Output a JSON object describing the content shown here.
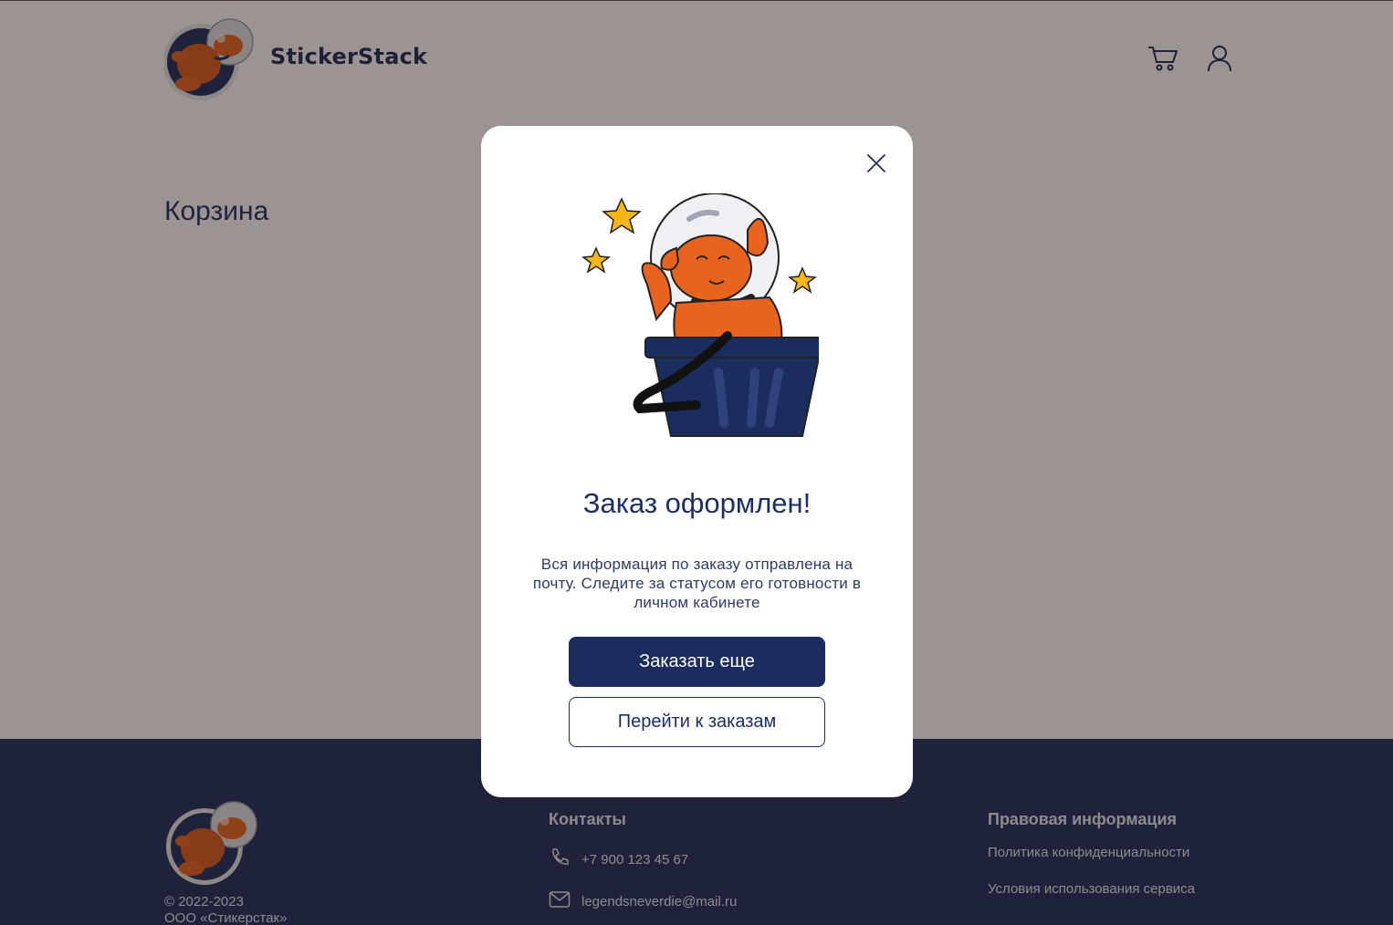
{
  "header": {
    "brand": "StickerStack",
    "cart_icon": "cart-icon",
    "user_icon": "user-icon"
  },
  "main": {
    "title": "Корзина"
  },
  "footer": {
    "copyright_line1": "© 2022-2023",
    "copyright_line2": "ООО «Стикерстак»",
    "contacts_title": "Контакты",
    "phone": "+7 900 123 45 67",
    "email": "legendsneverdie@mail.ru",
    "legal_title": "Правовая информация",
    "legal_links": [
      "Политика конфиденциальности",
      "Условия использования сервиса"
    ]
  },
  "modal": {
    "title": "Заказ оформлен!",
    "text": "Вся информация по заказу отправлена на почту. Следите за статусом его готовности в личном кабинете",
    "primary_button": "Заказать еще",
    "secondary_button": "Перейти к заказам",
    "close_icon": "close-icon"
  },
  "colors": {
    "navy": "#1b2d5f",
    "accent_orange": "#e8641e",
    "star_yellow": "#f5b51b",
    "overlay": "rgba(38,22,18,0.46)"
  }
}
